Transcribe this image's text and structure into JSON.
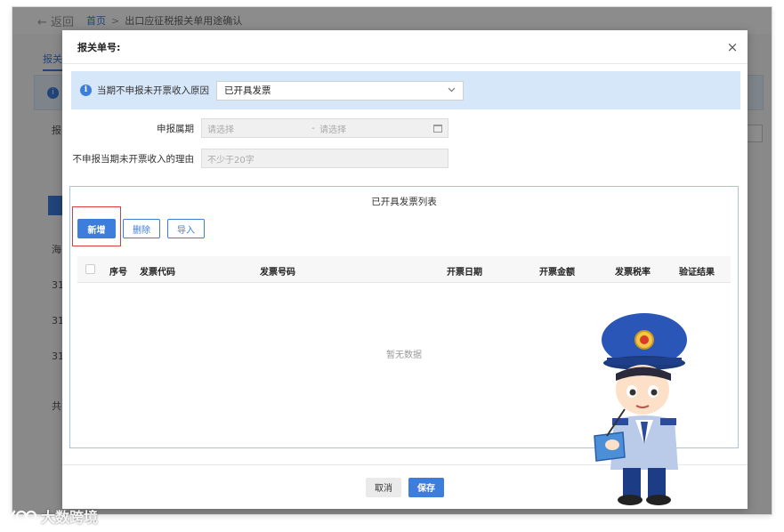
{
  "background": {
    "back_label": "返回",
    "breadcrumb_home": "首页",
    "breadcrumb_sep": ">",
    "breadcrumb_current": "出口应征税报关单用途确认",
    "tab_label": "报关",
    "left_labels": [
      "报",
      "海",
      "31",
      "31",
      "31",
      "共"
    ]
  },
  "modal": {
    "title": "报关单号:",
    "close_glyph": "×",
    "reason": {
      "info_glyph": "i",
      "label": "当期不申报未开票收入原因",
      "value": "已开具发票",
      "chevron": "⌄"
    },
    "period": {
      "label": "申报属期",
      "start_placeholder": "请选择",
      "separator": "-",
      "end_placeholder": "请选择"
    },
    "reason_text": {
      "label": "不申报当期未开票收入的理由",
      "placeholder": "不少于20字"
    },
    "list": {
      "title": "已开具发票列表",
      "buttons": {
        "add": "新增",
        "delete": "删除",
        "import": "导入"
      },
      "columns": [
        "序号",
        "发票代码",
        "发票号码",
        "开票日期",
        "开票金额",
        "发票税率",
        "验证结果"
      ],
      "empty_text": "暂无数据"
    },
    "footer": {
      "cancel": "取消",
      "save": "保存"
    }
  },
  "watermark": {
    "text": "大数跨境"
  },
  "colors": {
    "primary": "#3d7ddc",
    "info_bg": "#d7e7fa",
    "highlight": "#e03b3b"
  }
}
